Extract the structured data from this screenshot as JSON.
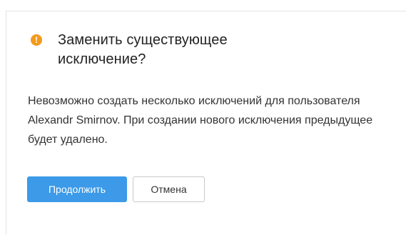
{
  "dialog": {
    "icon": "warning-icon",
    "icon_glyph": "!",
    "title": "Заменить существующее исключение?",
    "message": "Невозможно создать несколько исключений для пользователя Alexandr Smirnov. При создании нового исключения предыдущее будет удалено.",
    "continue_label": "Продолжить",
    "cancel_label": "Отмена"
  },
  "colors": {
    "primary": "#3c9ae8",
    "warning": "#f39a1b"
  }
}
